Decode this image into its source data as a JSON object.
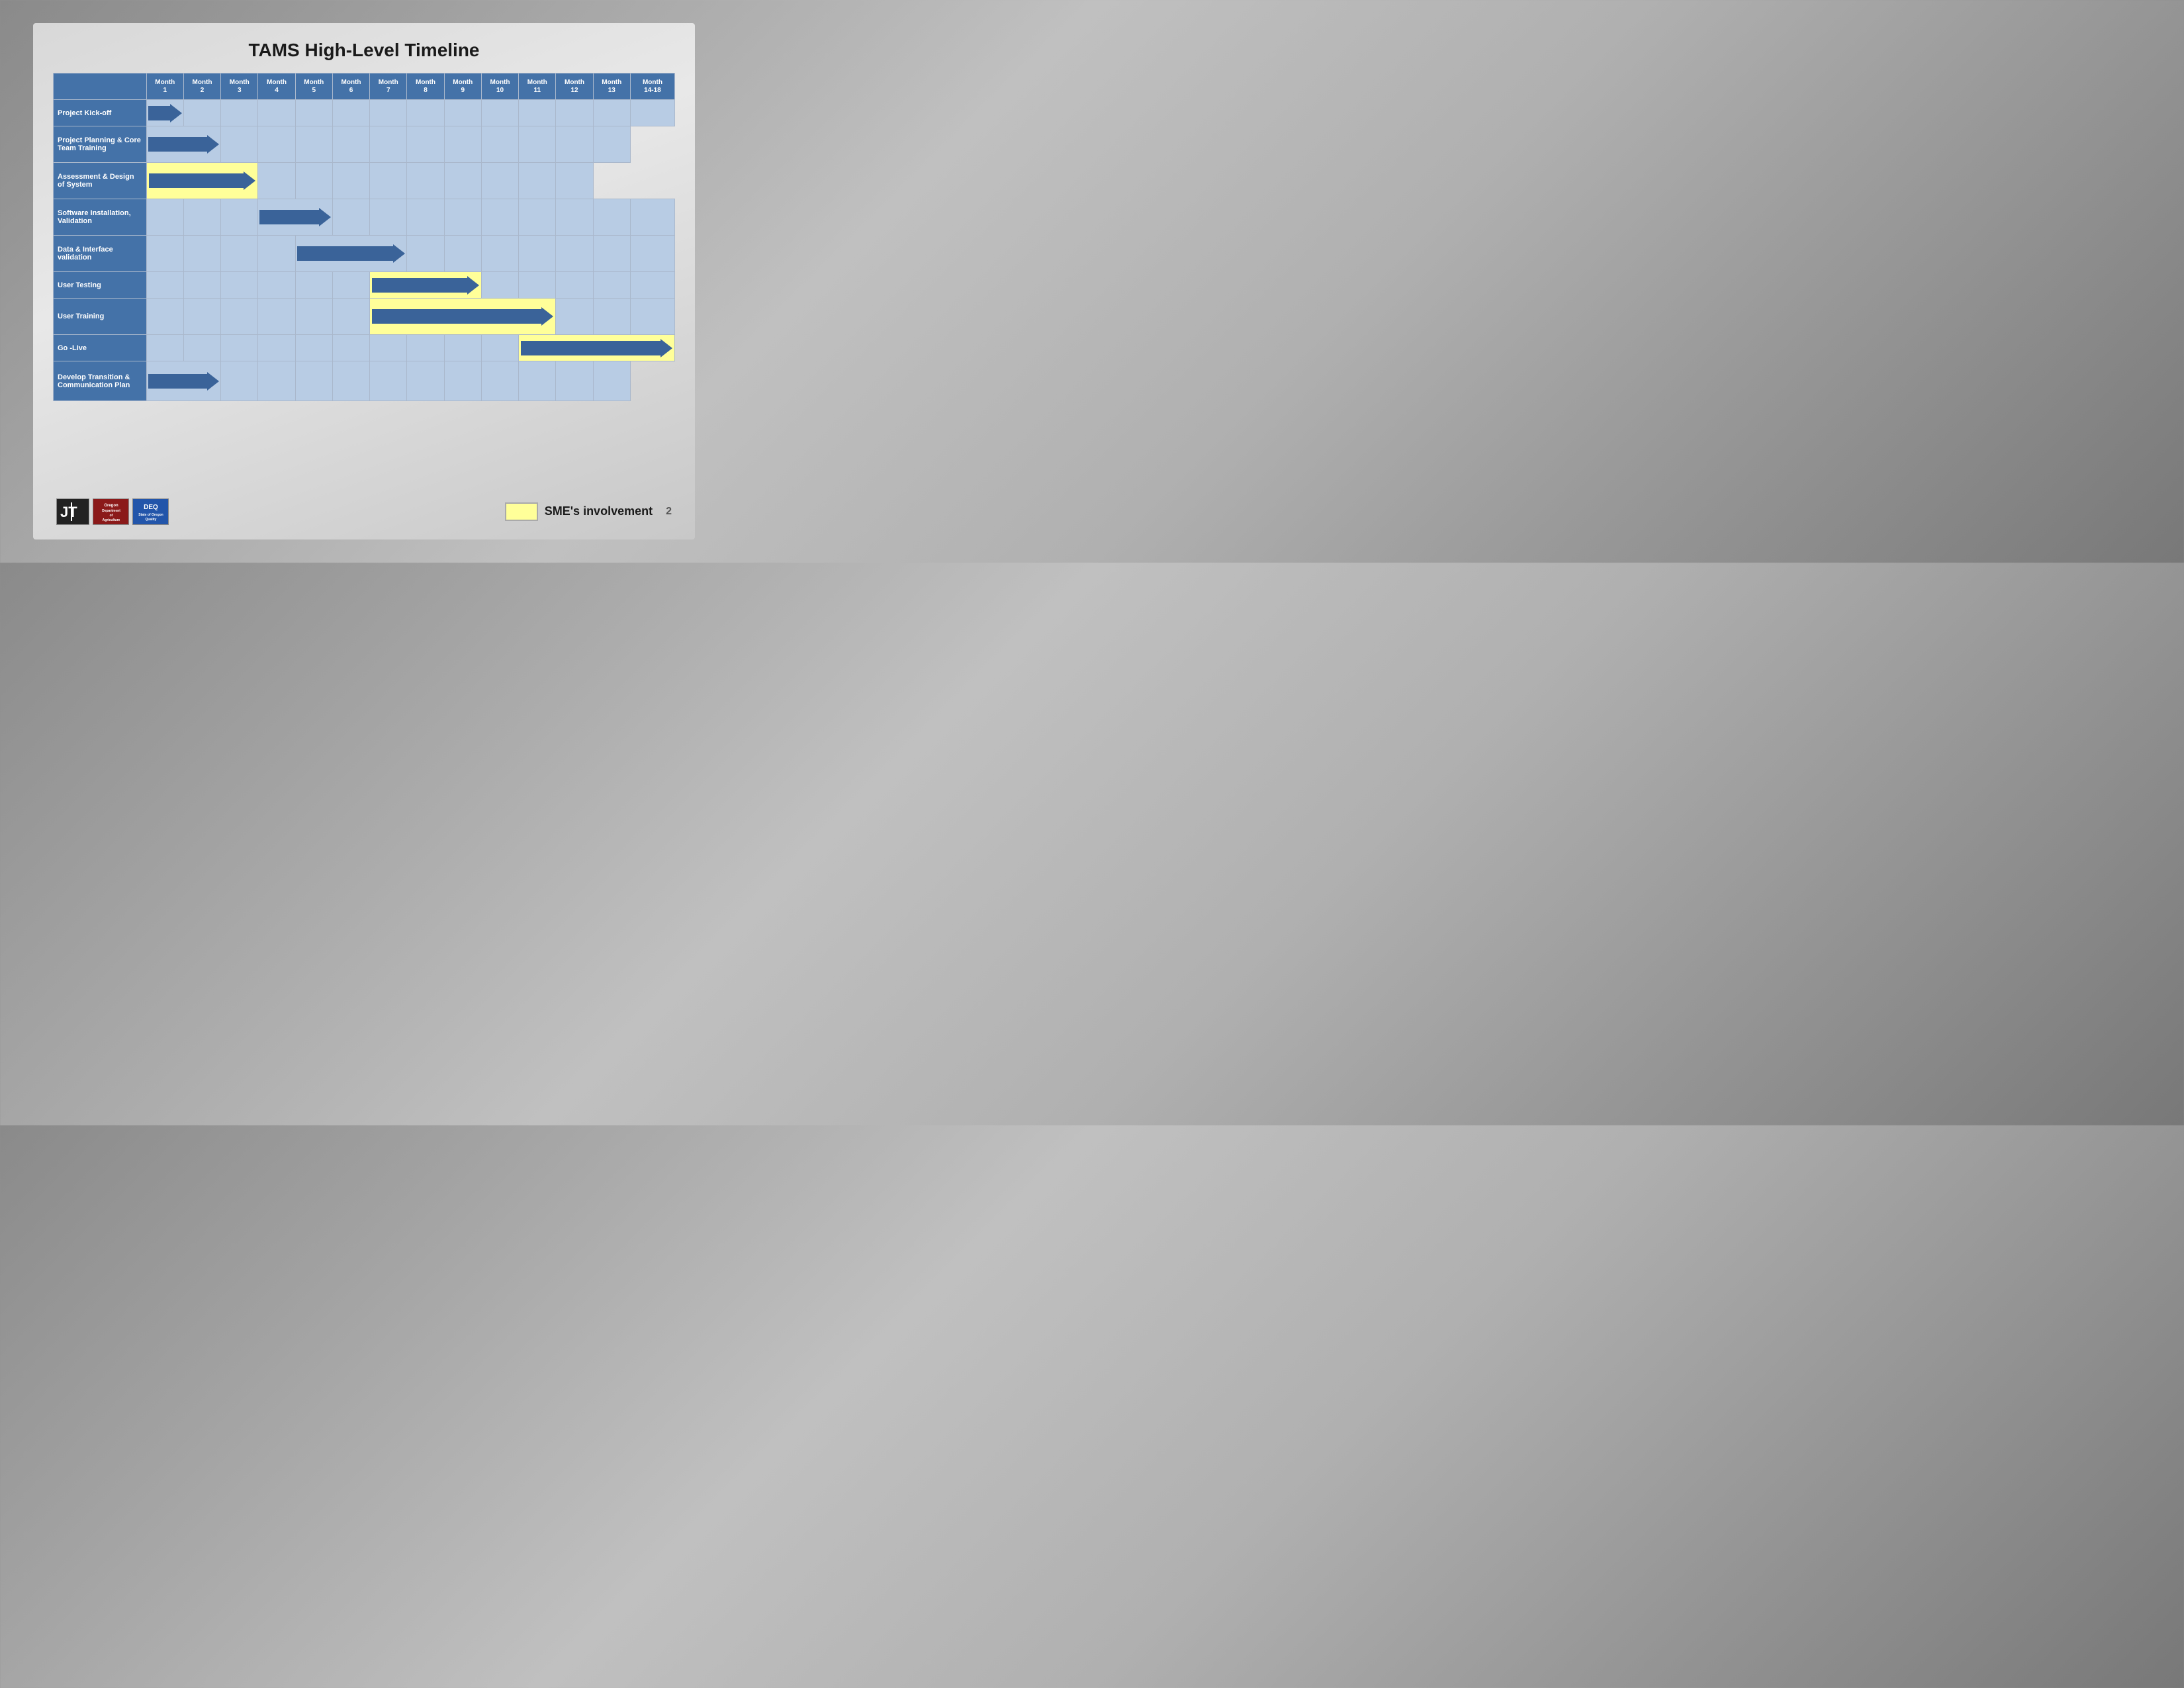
{
  "title": "TAMS High-Level Timeline",
  "months": [
    {
      "label": "Month",
      "sub": "1"
    },
    {
      "label": "Month",
      "sub": "2"
    },
    {
      "label": "Month",
      "sub": "3"
    },
    {
      "label": "Month",
      "sub": "4"
    },
    {
      "label": "Month",
      "sub": "5"
    },
    {
      "label": "Month",
      "sub": "6"
    },
    {
      "label": "Month",
      "sub": "7"
    },
    {
      "label": "Month",
      "sub": "8"
    },
    {
      "label": "Month",
      "sub": "9"
    },
    {
      "label": "Month",
      "sub": "10"
    },
    {
      "label": "Month",
      "sub": "11"
    },
    {
      "label": "Month",
      "sub": "12"
    },
    {
      "label": "Month",
      "sub": "13"
    },
    {
      "label": "Month",
      "sub": "14-18"
    }
  ],
  "tasks": [
    {
      "name": "Project Kick-off",
      "arrow_start": 0,
      "arrow_end": 0,
      "sme": false,
      "multiline": false
    },
    {
      "name": "Project Planning & Core Team Training",
      "arrow_start": 0,
      "arrow_end": 1,
      "sme": false,
      "multiline": true
    },
    {
      "name": "Assessment & Design of System",
      "arrow_start": 0,
      "arrow_end": 2,
      "sme": true,
      "multiline": true
    },
    {
      "name": "Software Installation, Validation",
      "arrow_start": 3,
      "arrow_end": 4,
      "sme": false,
      "multiline": true
    },
    {
      "name": "Data & Interface validation",
      "arrow_start": 4,
      "arrow_end": 6,
      "sme": false,
      "multiline": true
    },
    {
      "name": "User Testing",
      "arrow_start": 6,
      "arrow_end": 8,
      "sme": true,
      "multiline": false
    },
    {
      "name": "User Training",
      "arrow_start": 6,
      "arrow_end": 10,
      "sme": true,
      "multiline": true
    },
    {
      "name": "Go -Live",
      "arrow_start": 10,
      "arrow_end": 13,
      "sme": true,
      "multiline": false
    },
    {
      "name": "Develop Transition & Communication Plan",
      "arrow_start": 0,
      "arrow_end": 1,
      "sme": false,
      "multiline": true
    }
  ],
  "legend": {
    "label": "SME's involvement"
  },
  "footer": {
    "page": "2"
  }
}
